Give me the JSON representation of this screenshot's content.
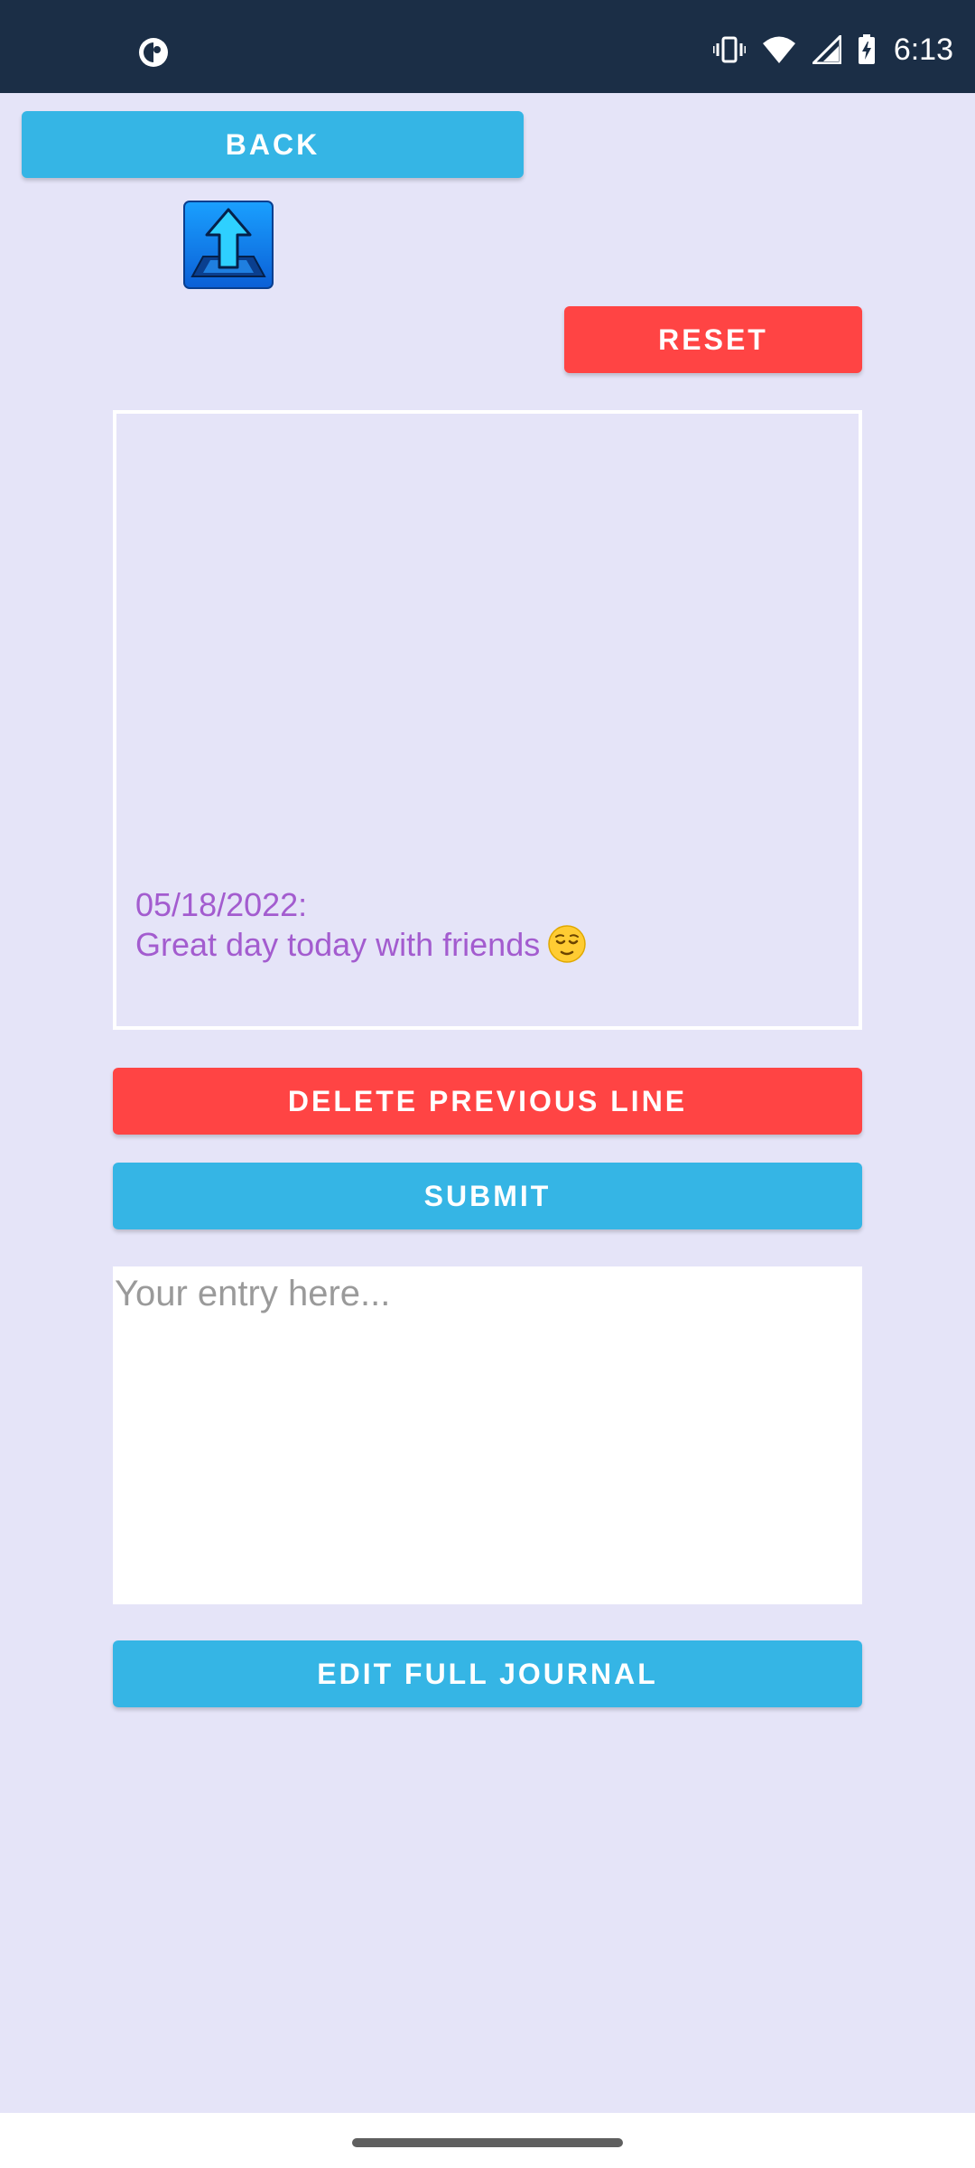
{
  "status_bar": {
    "time": "6:13",
    "left_icon": "notification-app-icon",
    "right_icons": [
      "vibrate-icon",
      "wifi-icon",
      "signal-icon",
      "battery-charging-icon"
    ]
  },
  "buttons": {
    "back": "BACK",
    "reset": "RESET",
    "delete_previous_line": "DELETE PREVIOUS LINE",
    "submit": "SUBMIT",
    "edit_full_journal": "EDIT FULL JOURNAL"
  },
  "journal": {
    "date_line": "05/18/2022:",
    "entry_line": "Great day today with friends",
    "emoji": "relieved-face-emoji"
  },
  "entry_input": {
    "placeholder": "Your entry here...",
    "value": ""
  },
  "icons": {
    "upload": "upload-icon"
  },
  "colors": {
    "background": "#e5e4f8",
    "status_bar": "#1b2e46",
    "blue_button": "#35b5e5",
    "red_button": "#ff4444",
    "journal_text": "#a35ccf"
  }
}
